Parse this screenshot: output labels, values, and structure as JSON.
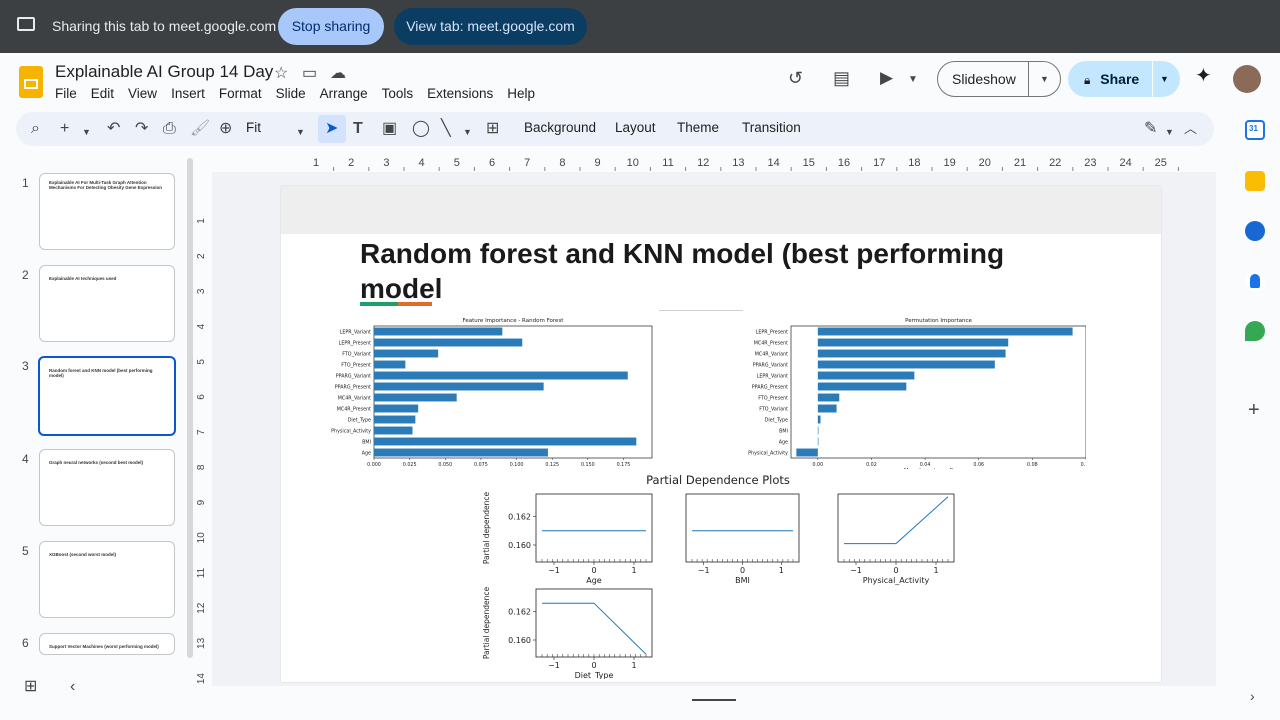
{
  "share_bar": {
    "message": "Sharing this tab to meet.google.com",
    "stop_label": "Stop sharing",
    "view_label": "View tab: meet.google.com"
  },
  "doc": {
    "title": "Explainable AI Group 14 Day",
    "menu": [
      "File",
      "Edit",
      "View",
      "Insert",
      "Format",
      "Slide",
      "Arrange",
      "Tools",
      "Extensions",
      "Help"
    ],
    "slideshow_label": "Slideshow",
    "share_label": "Share"
  },
  "toolbar": {
    "zoom_label": "Fit",
    "background_label": "Background",
    "layout_label": "Layout",
    "theme_label": "Theme",
    "transition_label": "Transition"
  },
  "ruler": {
    "top_ticks": [
      "1",
      "2",
      "3",
      "4",
      "5",
      "6",
      "7",
      "8",
      "9",
      "10",
      "11",
      "12",
      "13",
      "14",
      "15",
      "16",
      "17",
      "18",
      "19",
      "20",
      "21",
      "22",
      "23",
      "24",
      "25"
    ],
    "left_ticks": [
      "1",
      "2",
      "3",
      "4",
      "5",
      "6",
      "7",
      "8",
      "9",
      "10",
      "11",
      "12",
      "13",
      "14"
    ]
  },
  "filmstrip": [
    {
      "num": "1",
      "title": "Explainable AI For Multi-Task Graph Attention Mechanisms For Detecting Obesity Gene Expression"
    },
    {
      "num": "2",
      "title": "Explainable AI techniques used"
    },
    {
      "num": "3",
      "title": "Random forest and KNN model (best performing model)"
    },
    {
      "num": "4",
      "title": "Graph neural networks (second best model)"
    },
    {
      "num": "5",
      "title": "XGBoost (second worst model)"
    },
    {
      "num": "6",
      "title": "Support Vector Machines (worst performing model)"
    }
  ],
  "slide": {
    "title": "Random forest and KNN model (best performing model"
  },
  "feature_importance": {
    "title": "Feature Importance - Random Forest",
    "labels": [
      "LEPR_Variant",
      "LEPR_Present",
      "FTO_Variant",
      "FTO_Present",
      "PPARG_Variant",
      "PPARG_Present",
      "MC4R_Variant",
      "MC4R_Present",
      "Diet_Type",
      "Physical_Activity",
      "BMI",
      "Age"
    ],
    "values": [
      0.09,
      0.104,
      0.045,
      0.022,
      0.178,
      0.119,
      0.058,
      0.031,
      0.029,
      0.027,
      0.184,
      0.122
    ],
    "ticks": [
      "0.000",
      "0.025",
      "0.050",
      "0.075",
      "0.100",
      "0.125",
      "0.150",
      "0.175"
    ],
    "xmax": 0.195
  },
  "permutation_importance": {
    "title": "Permutation Importance",
    "xlabel": "Mean Importance Decrease",
    "labels": [
      "LEPR_Present",
      "MC4R_Present",
      "MC4R_Variant",
      "PPARG_Variant",
      "LEPR_Variant",
      "PPARG_Present",
      "FTO_Present",
      "FTO_Variant",
      "Diet_Type",
      "BMI",
      "Age",
      "Physical_Activity"
    ],
    "values": [
      0.095,
      0.071,
      0.07,
      0.066,
      0.036,
      0.033,
      0.008,
      0.007,
      0.001,
      0.0,
      0.0,
      -0.008
    ],
    "ticks": [
      "0.00",
      "0.02",
      "0.04",
      "0.06",
      "0.08",
      "0.10"
    ],
    "xmin": -0.01,
    "xmax": 0.1
  },
  "pdp": {
    "title": "Partial Dependence Plots",
    "ylabel": "Partial dependence",
    "yticks": [
      "0.162",
      "0.160"
    ],
    "xticks": [
      "−1",
      "0",
      "1"
    ],
    "panels": [
      {
        "xlabel": "Age",
        "points": [
          [
            -1.3,
            0.161
          ],
          [
            1.3,
            0.161
          ]
        ]
      },
      {
        "xlabel": "BMI",
        "points": [
          [
            -1.3,
            0.161
          ],
          [
            1.3,
            0.161
          ]
        ]
      },
      {
        "xlabel": "Physical_Activity",
        "points": [
          [
            -1.3,
            0.1601
          ],
          [
            0,
            0.1601
          ],
          [
            1.3,
            0.1634
          ]
        ]
      },
      {
        "xlabel": "Diet_Type",
        "points": [
          [
            -1.3,
            0.1626
          ],
          [
            0,
            0.1626
          ],
          [
            1.3,
            0.159
          ]
        ]
      }
    ]
  },
  "colors": {
    "bar": "#2b7bb9",
    "accent_green": "#1e9e6a",
    "accent_orange": "#e26a2c",
    "share_blue": "#c2e7ff",
    "selected": "#0b57d0"
  }
}
